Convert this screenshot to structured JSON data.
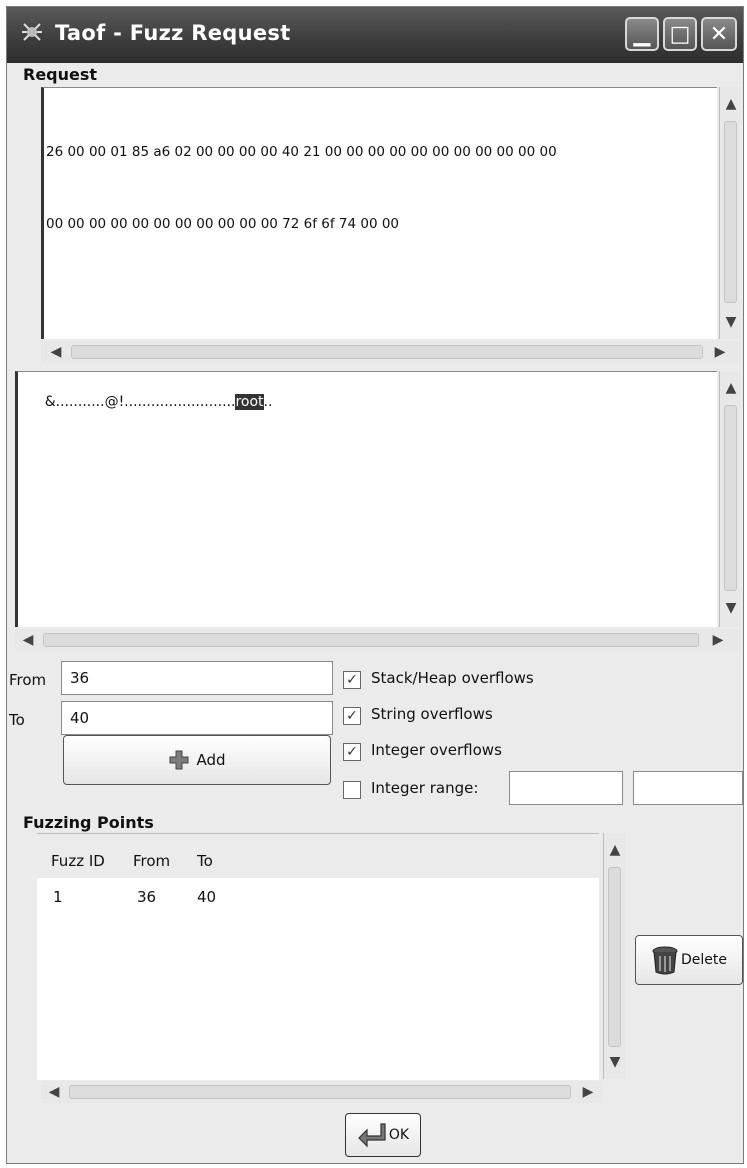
{
  "window": {
    "title": "Taof - Fuzz Request",
    "controls": {
      "minimize": "▁",
      "maximize": "□",
      "close": "✕"
    }
  },
  "request": {
    "label": "Request",
    "hex_lines": [
      "26 00 00 01 85 a6 02 00 00 00 00 40 21 00 00 00 00 00 00 00 00 00 00 00",
      "00 00 00 00 00 00 00 00 00 00 00 72 6f 6f 74 00 00"
    ],
    "ascii_before": "&...........@!.........................",
    "ascii_selected": "root",
    "ascii_after": ".."
  },
  "range": {
    "from_label": "From",
    "from_value": "36",
    "to_label": "To",
    "to_value": "40",
    "add_button": "Add"
  },
  "options": {
    "stack_heap": {
      "label": "Stack/Heap overflows",
      "checked": true
    },
    "string": {
      "label": "String overflows",
      "checked": true
    },
    "integer": {
      "label": "Integer overflows",
      "checked": true
    },
    "integer_range": {
      "label": "Integer range:",
      "checked": false,
      "min": "",
      "max": ""
    }
  },
  "fuzzing_points": {
    "label": "Fuzzing Points",
    "columns": [
      "Fuzz ID",
      "From",
      "To"
    ],
    "rows": [
      {
        "id": "1",
        "from": "36",
        "to": "40"
      }
    ],
    "delete_button": "Delete"
  },
  "footer": {
    "ok_button": "OK"
  }
}
